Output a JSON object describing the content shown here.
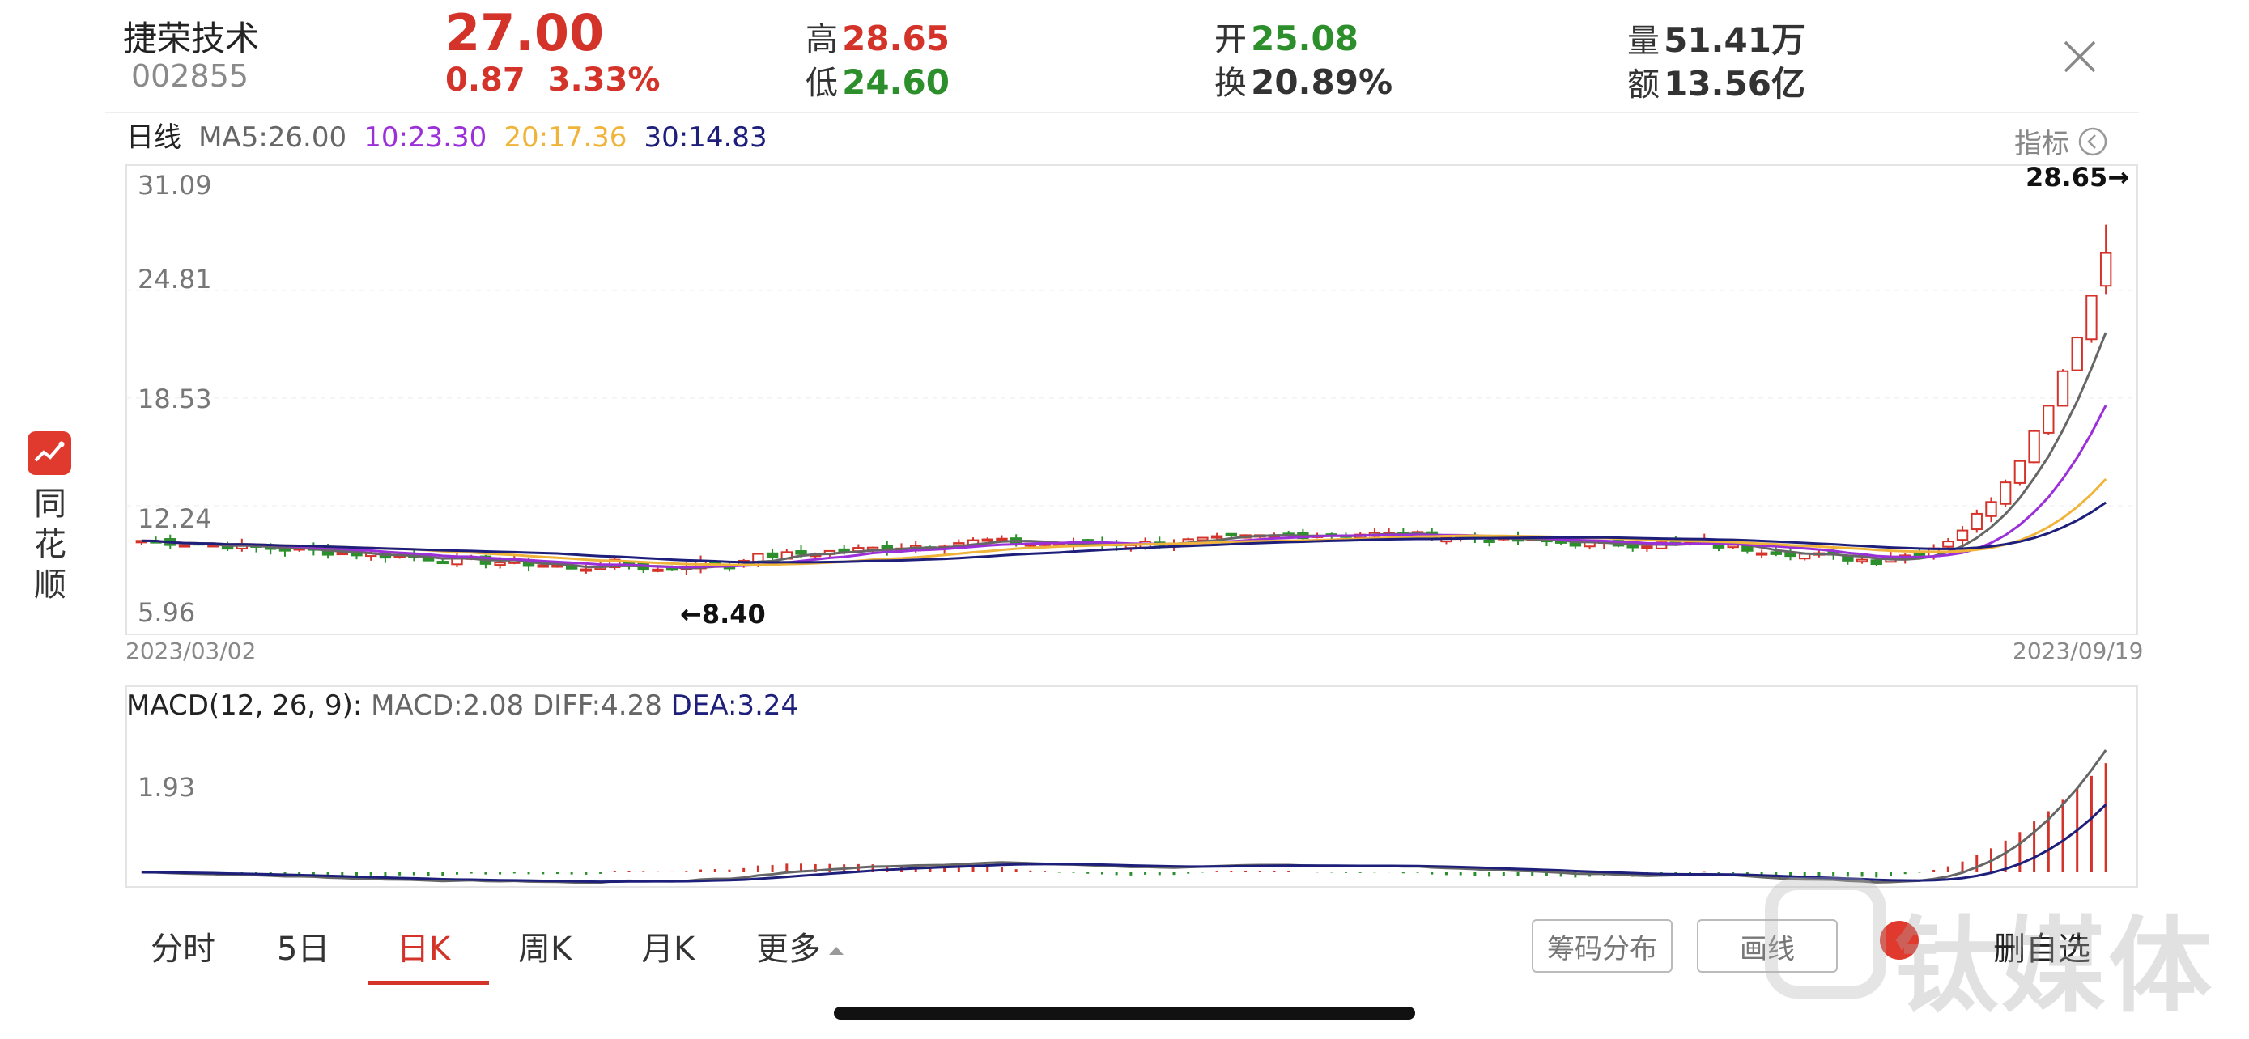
{
  "stock": {
    "name": "捷荣技术",
    "code": "002855",
    "price": "27.00",
    "change": "0.87",
    "change_pct": "3.33%",
    "high_label": "高",
    "high": "28.65",
    "low_label": "低",
    "low": "24.60",
    "open_label": "开",
    "open": "25.08",
    "turnover_label": "换",
    "turnover": "20.89%",
    "volume_label": "量",
    "volume": "51.41万",
    "amount_label": "额",
    "amount": "13.56亿"
  },
  "ma_bar": {
    "period": "日线",
    "ma5": "MA5:26.00",
    "ma10": "10:23.30",
    "ma20": "20:17.36",
    "ma30": "30:14.83",
    "indicator_label": "指标"
  },
  "kline": {
    "y_ticks": [
      "31.09",
      "24.81",
      "18.53",
      "12.24",
      "5.96"
    ],
    "start_date": "2023/03/02",
    "end_date": "2023/09/19",
    "high_marker": "28.65→",
    "low_marker": "←8.40"
  },
  "macd": {
    "title": "MACD(12, 26, 9):",
    "macd": "MACD:2.08",
    "diff": "DIFF:4.28",
    "dea": "DEA:3.24",
    "y_tick": "1.93"
  },
  "sidebar": {
    "brand_chars": [
      "同",
      "花",
      "顺"
    ]
  },
  "tabs": [
    "分时",
    "5日",
    "日K",
    "周K",
    "月K",
    "更多"
  ],
  "active_tab": "日K",
  "buttons": {
    "chip_distribution": "筹码分布",
    "draw_line": "画线",
    "remove_watchlist": "删自选"
  },
  "watermark": "钛媒体",
  "colors": {
    "up": "#d4332a",
    "down": "#2c8f2c",
    "ma5": "#666666",
    "ma10": "#9b30d9",
    "ma20": "#f0b43a",
    "ma30": "#1d1f7a"
  },
  "chart_data": {
    "type": "candlestick",
    "x_range": [
      "2023/03/02",
      "2023/09/19"
    ],
    "ylim": [
      5.96,
      31.09
    ],
    "high": 28.65,
    "low": 8.4,
    "last": {
      "open": 25.08,
      "high": 28.65,
      "low": 24.6,
      "close": 27.0
    },
    "ma": {
      "ma5": 26.0,
      "ma10": 23.3,
      "ma20": 17.36,
      "ma30": 14.83
    },
    "macd": {
      "macd": 2.08,
      "diff": 4.28,
      "dea": 3.24,
      "tick": 1.93
    }
  }
}
